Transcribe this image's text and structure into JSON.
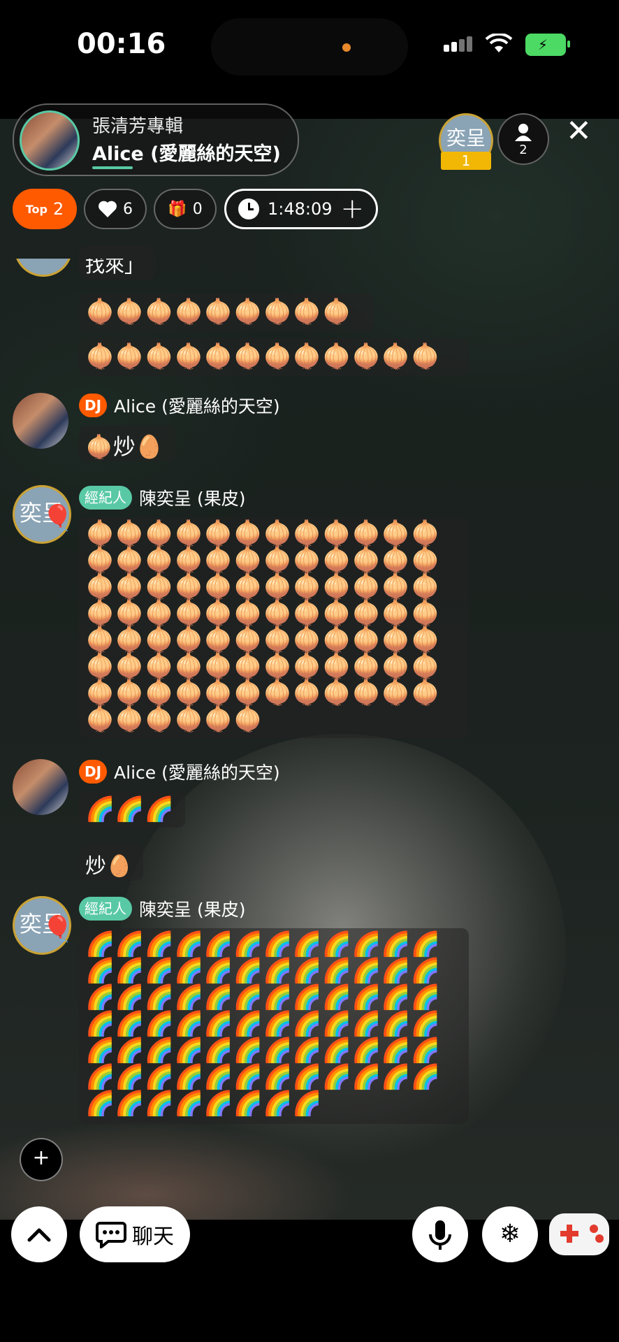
{
  "status_bar": {
    "time": "00:16"
  },
  "room": {
    "title": "張清芳專輯",
    "host_name": "Alice (愛麗絲的天空)",
    "rank_avatar_text": "奕呈",
    "rank_badge": "1",
    "viewer_count": "2"
  },
  "stats": {
    "top_label": "Top",
    "top_value": "2",
    "likes": "6",
    "gifts": "0",
    "timer": "1:48:09"
  },
  "chat": {
    "partial_text": "找來」",
    "msg1_row1": "🧅🧅🧅🧅🧅🧅🧅🧅🧅",
    "msg1_row2": "🧅🧅🧅🧅🧅🧅🧅🧅🧅🧅🧅🧅",
    "dj_tag": "DJ",
    "agent_tag": "經紀人",
    "dj_name": "Alice (愛麗絲的天空)",
    "agent_name": "陳奕呈 (果皮)",
    "agent_avatar_text": "奕呈",
    "msg2": "🧅炒🥚",
    "onion_full_row": "🧅🧅🧅🧅🧅🧅🧅🧅🧅🧅🧅🧅",
    "onion_last_row": "🧅🧅🧅🧅🧅🧅",
    "msg4": "🌈🌈🌈",
    "msg5": "炒🥚",
    "rainbow_full_row": "🌈🌈🌈🌈🌈🌈🌈🌈🌈🌈🌈🌈",
    "rainbow_last_row": "🌈🌈🌈🌈🌈🌈🌈🌈"
  },
  "bottom": {
    "chat_label": "聊天"
  },
  "icons": {
    "like": "heart-icon",
    "gift": "gift-icon",
    "timer": "clock-icon",
    "mic": "microphone-icon",
    "effects": "snowflake-icon",
    "game": "gamepad-icon"
  },
  "colors": {
    "accent_orange": "#ff5a00",
    "accent_green": "#59c9a5",
    "rank_gold": "#f2b705"
  }
}
